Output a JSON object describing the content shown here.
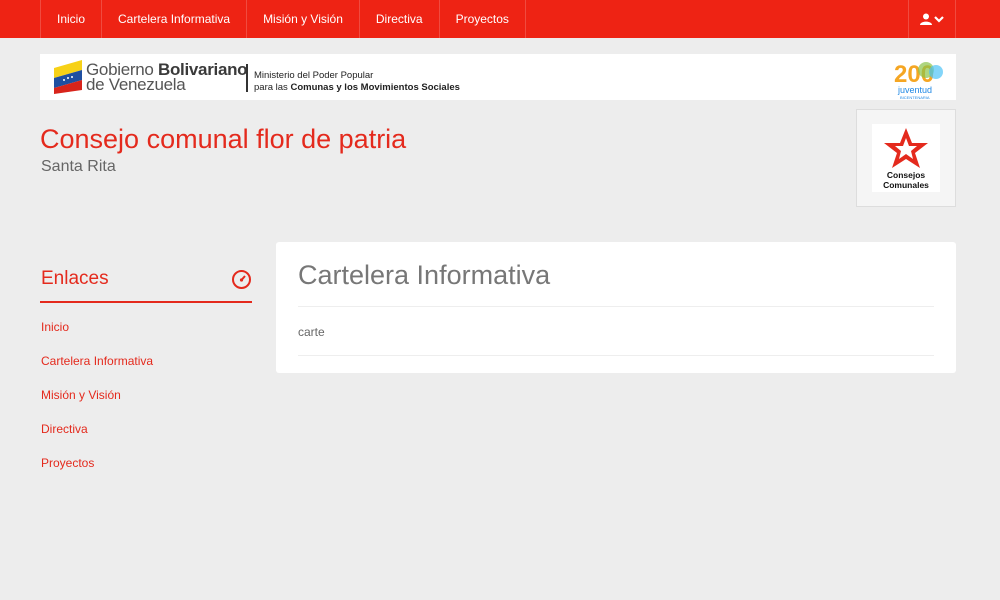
{
  "topnav": {
    "items": [
      "Inicio",
      "Cartelera Informativa",
      "Misión y Visión",
      "Directiva",
      "Proyectos"
    ],
    "user_icon": "user-icon",
    "chevron_icon": "chevron-down-icon"
  },
  "banner": {
    "gov_prefix": "Gobierno",
    "gov_bold": "Bolivariano",
    "gov_line2": "de Venezuela",
    "ministry_line1": "Ministerio del Poder Popular",
    "ministry_line2_prefix": "para las",
    "ministry_line2_bold": "Comunas y los Movimientos Sociales",
    "logo_number": "200",
    "logo_text": "juventud",
    "logo_sub": "BICENTENARIA"
  },
  "header": {
    "title": "Consejo comunal flor de patria",
    "subtitle": "Santa Rita",
    "logo_line1": "Consejos",
    "logo_line2": "Comunales"
  },
  "sidebar": {
    "title": "Enlaces",
    "icon": "dashboard-icon",
    "links": [
      "Inicio",
      "Cartelera Informativa",
      "Misión y Visión",
      "Directiva",
      "Proyectos"
    ]
  },
  "main": {
    "title": "Cartelera Informativa",
    "body": "carte"
  },
  "colors": {
    "accent": "#ee2314",
    "background": "#ededed"
  }
}
